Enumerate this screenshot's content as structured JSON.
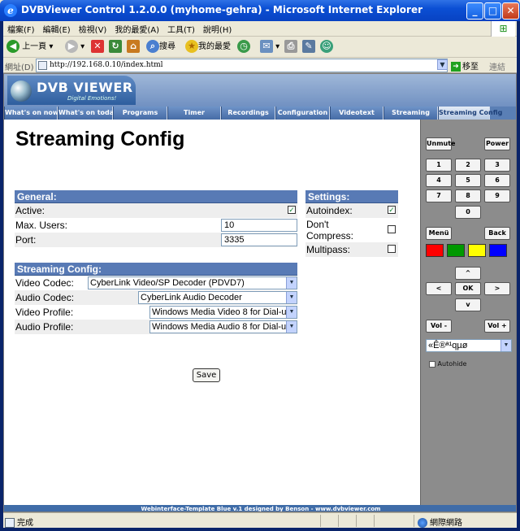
{
  "window": {
    "title": "DVBViewer Control 1.2.0.0 (myhome-gehra) - Microsoft Internet Explorer"
  },
  "menu": [
    "檔案(F)",
    "編輯(E)",
    "檢視(V)",
    "我的最愛(A)",
    "工具(T)",
    "說明(H)"
  ],
  "toolbar": {
    "back": "上一頁",
    "search": "搜尋",
    "favorites": "我的最愛"
  },
  "address": {
    "label": "網址(D)",
    "url": "http://192.168.0.10/index.html",
    "go": "移至",
    "links": "連結"
  },
  "header": {
    "logo_title": "DVB VIEWER",
    "logo_sub": "Digital Emotions!"
  },
  "nav": [
    "What's on now?",
    "What's on today?",
    "Programs",
    "Timer",
    "Recordings",
    "Configuration",
    "Videotext",
    "Streaming",
    "Streaming Config"
  ],
  "page": {
    "title": "Streaming Config"
  },
  "general": {
    "heading": "General:",
    "active_label": "Active:",
    "active_checked": true,
    "max_users_label": "Max. Users:",
    "max_users_value": "10",
    "port_label": "Port:",
    "port_value": "3335"
  },
  "settings": {
    "heading": "Settings:",
    "autoindex_label": "Autoindex:",
    "autoindex_checked": true,
    "dont_compress_label": "Don't Compress:",
    "dont_compress_checked": false,
    "multipass_label": "Multipass:",
    "multipass_checked": false
  },
  "streaming": {
    "heading": "Streaming Config:",
    "video_codec_label": "Video Codec:",
    "video_codec_value": "CyberLink Video/SP Decoder (PDVD7)",
    "audio_codec_label": "Audio Codec:",
    "audio_codec_value": "CyberLink Audio Decoder",
    "video_profile_label": "Video Profile:",
    "video_profile_value": "Windows Media Video 8 for Dial-u",
    "audio_profile_label": "Audio Profile:",
    "audio_profile_value": "Windows Media Audio 8 for Dial-u"
  },
  "save_label": "Save",
  "remote": {
    "unmute": "Unmute",
    "power": "Power",
    "digits": [
      "1",
      "2",
      "3",
      "4",
      "5",
      "6",
      "7",
      "8",
      "9",
      "0"
    ],
    "menu": "Menü",
    "back": "Back",
    "colors": [
      "#ff0000",
      "#009900",
      "#ffff00",
      "#0000ff"
    ],
    "up": "^",
    "left": "<",
    "ok": "OK",
    "right": ">",
    "down": "v",
    "vol_down": "Vol -",
    "vol_up": "Vol +",
    "channel_value": "«Ê®ª¹qµø",
    "autohide_label": "Autohide"
  },
  "footer": "Webinterface-Template Blue v.1 designed by Benson - www.dvbviewer.com",
  "status": {
    "left": "完成",
    "zone": "網際網路"
  }
}
